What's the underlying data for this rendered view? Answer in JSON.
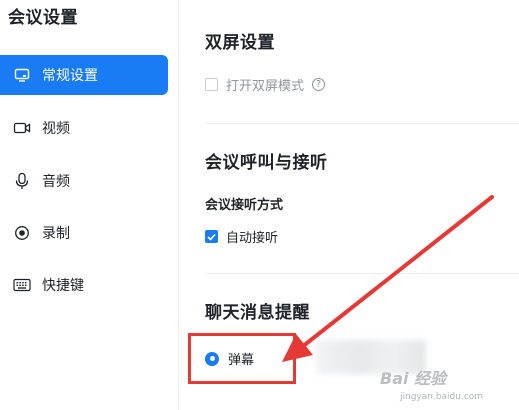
{
  "sidebar": {
    "title": "会议设置",
    "items": [
      {
        "label": "常规设置",
        "icon": "monitor-icon",
        "active": true
      },
      {
        "label": "视频",
        "icon": "camera-icon",
        "active": false
      },
      {
        "label": "音频",
        "icon": "microphone-icon",
        "active": false
      },
      {
        "label": "录制",
        "icon": "record-icon",
        "active": false
      },
      {
        "label": "快捷键",
        "icon": "keyboard-icon",
        "active": false
      }
    ]
  },
  "main": {
    "dual_screen": {
      "title": "双屏设置",
      "option_label": "打开双屏模式",
      "checked": false
    },
    "call_answer": {
      "title": "会议呼叫与接听",
      "subtitle": "会议接听方式",
      "option_label": "自动接听",
      "checked": true
    },
    "chat_notify": {
      "title": "聊天消息提醒",
      "option_label": "弹幕",
      "selected": true
    }
  },
  "watermark": {
    "text": "Bai 经验",
    "sub": "jingyan.baidu.com"
  },
  "colors": {
    "accent": "#1a7cf5",
    "annotation": "#e53935"
  }
}
